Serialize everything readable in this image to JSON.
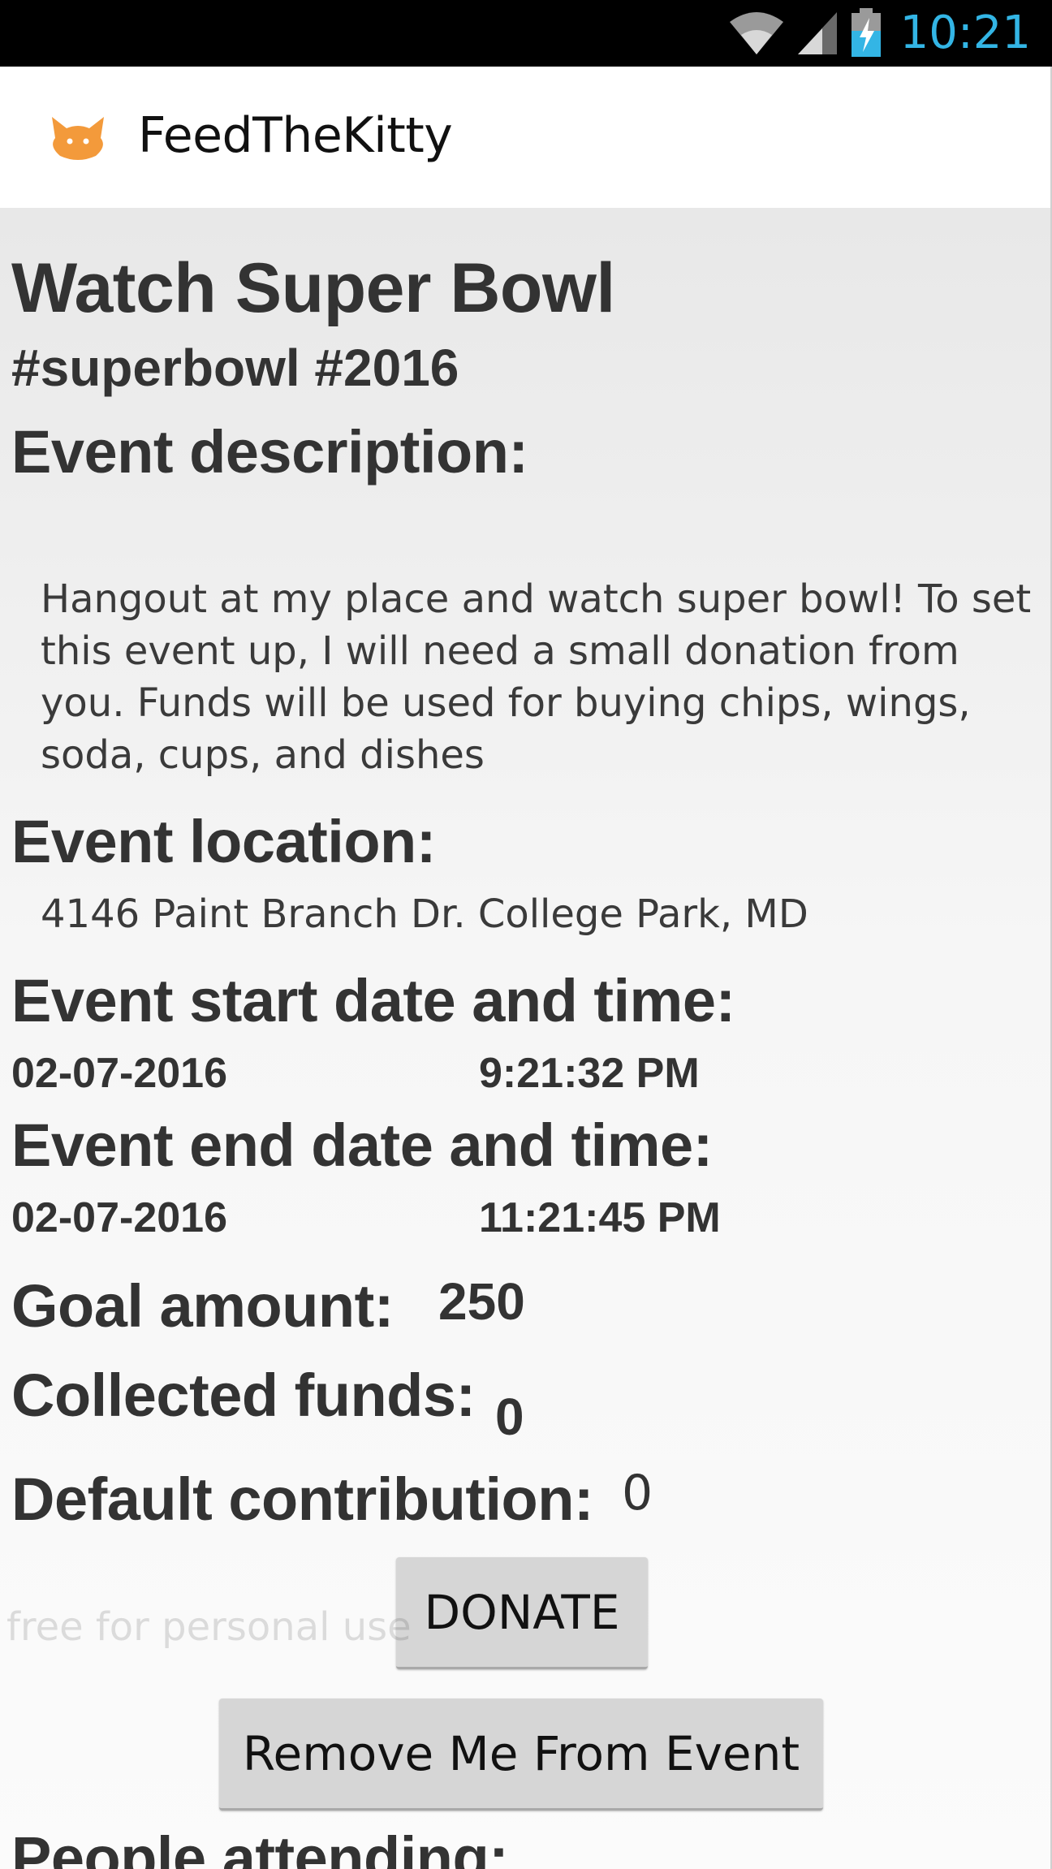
{
  "status_bar": {
    "time": "10:21",
    "icons": [
      "wifi-icon",
      "signal-icon",
      "battery-charging-icon"
    ],
    "clock_color": "#33b5e5"
  },
  "app_bar": {
    "title": "FeedTheKitty",
    "logo_icon": "cat-icon",
    "logo_color": "#f39a3b"
  },
  "event": {
    "name": "Watch Super Bowl",
    "tags": "#superbowl #2016",
    "description_label": "Event description:",
    "description": "Hangout at my place and watch super bowl!  To set this event up, I will need a small donation from you. Funds will be used for buying chips, wings, soda, cups, and dishes",
    "location_label": "Event location:",
    "location": "4146 Paint Branch Dr. College Park, MD",
    "start_label": "Event start date and time:",
    "start_date": "02-07-2016",
    "start_time": "9:21:32 PM",
    "end_label": "Event end date and time:",
    "end_date": "02-07-2016",
    "end_time": "11:21:45 PM",
    "goal_label": "Goal amount:",
    "goal_value": "250",
    "collected_label": "Collected funds:",
    "collected_value": "0",
    "default_label": "Default contribution:",
    "default_value": "0",
    "attending_label": "People attending:"
  },
  "actions": {
    "donate_label": "DONATE",
    "remove_label": "Remove Me From Event"
  },
  "watermark": "free for personal use"
}
